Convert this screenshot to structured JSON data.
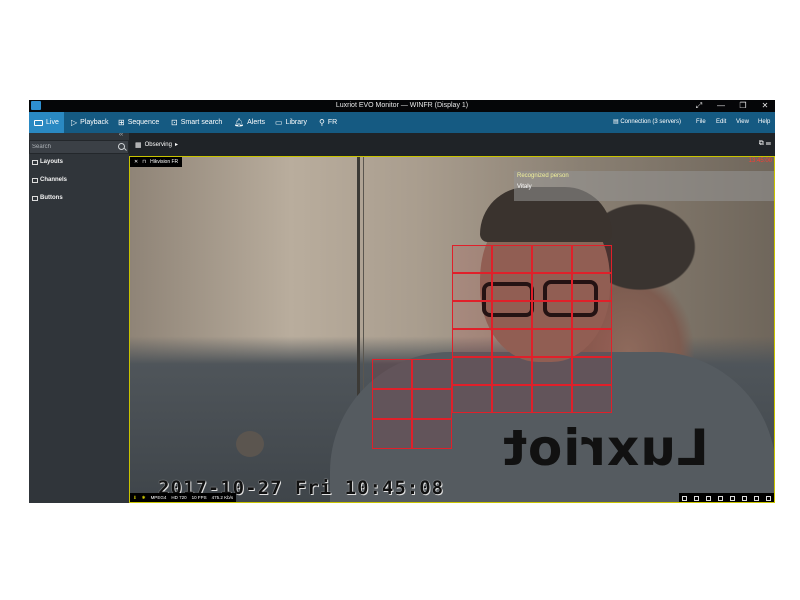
{
  "window": {
    "title": "Luxriot EVO Monitor — WINFR (Display 1)",
    "controls": [
      "⤢",
      "—",
      "❐",
      "✕"
    ]
  },
  "menu": {
    "tabs": [
      {
        "label": "Live",
        "icon": "monitor-icon",
        "active": true
      },
      {
        "label": "Playback",
        "icon": "play-icon"
      },
      {
        "label": "Sequence",
        "icon": "sequence-icon"
      },
      {
        "label": "Smart search",
        "icon": "smart-search-icon"
      },
      {
        "label": "Alerts",
        "icon": "bell-icon"
      },
      {
        "label": "Library",
        "icon": "folder-icon"
      },
      {
        "label": "FR",
        "icon": "person-icon"
      }
    ],
    "connection": "Connection (3 servers)",
    "right": [
      "File",
      "Edit",
      "View",
      "Help"
    ]
  },
  "sidebar": {
    "collapse": "‹‹",
    "search_placeholder": "Search",
    "items": [
      {
        "label": "Layouts",
        "icon": "layouts-icon"
      },
      {
        "label": "Channels",
        "icon": "channels-icon"
      },
      {
        "label": "Buttons",
        "icon": "buttons-icon"
      }
    ]
  },
  "toolbar": {
    "observing": "Observing",
    "arrow": "▸",
    "right_icons": "⧉ ☰"
  },
  "camera": {
    "close": "✕",
    "lock": "🔒",
    "name": "Hikvision FR",
    "time_small": "13:45:00",
    "match_label": "Recognized person",
    "match_name": "Vitaly",
    "osd_text": "2017-10-27 Fri 10:45:08",
    "watermark": "Luxriot",
    "status": {
      "codec": "MPEG4",
      "resolution": "HD 720",
      "fps": "10 FPS",
      "bitrate": "475.2 Kb/s"
    }
  },
  "colors": {
    "menu_bg": "#155a82",
    "active_tab": "#2a89c2",
    "sidebar_bg": "#30353a",
    "detection_grid": "#e0202a",
    "frame_border": "#c9c400"
  }
}
